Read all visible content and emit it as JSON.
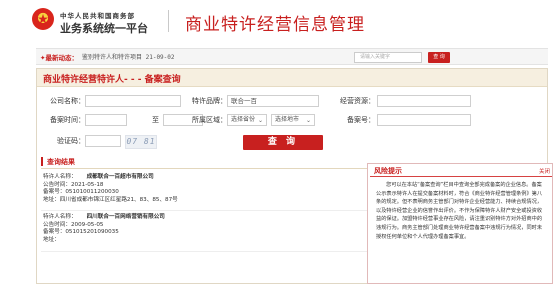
{
  "header": {
    "ministry": "中华人民共和国商务部",
    "platform": "业务系统统一平台",
    "title": "商业特许经营信息管理"
  },
  "newsbar": {
    "tag": "✦最新动态：",
    "text": "鉴别特许人和特许项目 21-09-02",
    "search_placeholder": "请输入关键字",
    "search_button": "查 询"
  },
  "panel": {
    "title": "商业特许经营特许人- - - 备案查询"
  },
  "form": {
    "company_label": "公司名称：",
    "company_value": "",
    "brand_label": "特许品牌：",
    "brand_value": "联合一百",
    "resource_label": "经营资源：",
    "resource_value": "",
    "date_label": "备案时间：",
    "date_from": "",
    "date_to_label": "至",
    "date_to": "",
    "region_label": "所属区域：",
    "province_select": "选择省份",
    "city_select": "选择地市",
    "record_no_label": "备案号：",
    "record_no_value": "",
    "captcha_label": "验证码：",
    "captcha_value": "",
    "captcha_image_text": "07 81",
    "query_button": "查 询"
  },
  "results": {
    "heading": "查询结果",
    "records": [
      {
        "franchisor_label": "特许人名称：",
        "franchisor": "成都联合一百超市有限公司",
        "date_line": "公告时间：2021-05-18",
        "no_line": "备案号：051010011200030",
        "addr_line": "地址：四川省成都市锦江区红星路21、83、85、87号"
      },
      {
        "franchisor_label": "特许人名称：",
        "franchisor": "四川联合一百网络营销有限公司",
        "date_line": "公告时间：2009-05-05",
        "no_line": "备案号：051015201090035",
        "addr_line": "地址："
      }
    ]
  },
  "popup": {
    "title": "风险提示",
    "close": "关闭",
    "body": "您可以在本站“备案查询”栏目中查询全部完成备案的企业信息。备案公示表示特许人在提交备案材料时，符合《商业特许经营管理条例》第八条的规定。但不表明商务主管部门对特许企业经营能力、持续合规情况，以及特许经营企业的信誉作出评价。不作为保障特许人财产安全或投资收益的保证。加盟特许经营事业存在风险，请注重识别特许方对外招商中的违规行为。商务主管部门处理商业特许经营备案中违规行为情况，同时未授权任何单位和个人代理办理备案事宜。"
  },
  "colors": {
    "accent_red": "#c8201f",
    "panel_title_bg": "#f6efe0"
  }
}
